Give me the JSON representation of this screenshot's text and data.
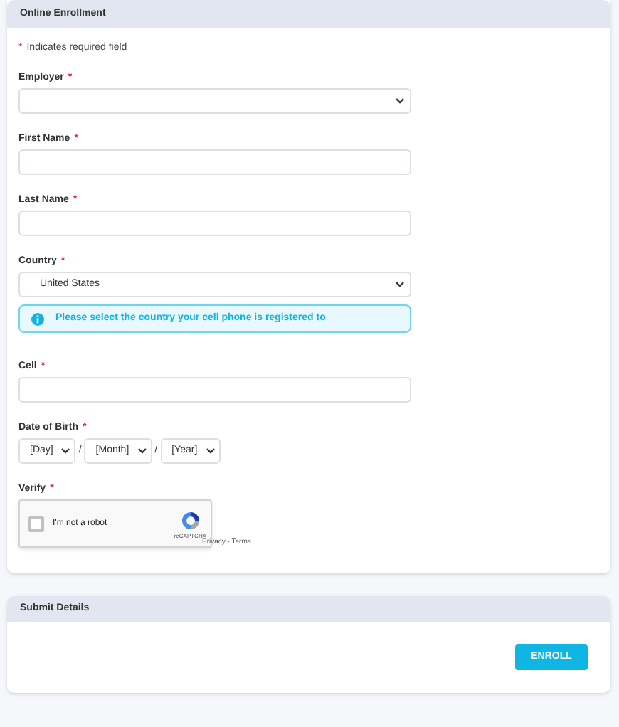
{
  "enrollment": {
    "title": "Online Enrollment",
    "required_note": {
      "mark": "*",
      "text": "Indicates required field"
    },
    "fields": [
      {
        "kind": "select",
        "label": "Employer",
        "required": true
      },
      {
        "kind": "text",
        "label": "First Name",
        "required": true
      },
      {
        "kind": "text",
        "label": "Last Name",
        "required": true
      },
      {
        "kind": "select",
        "label": "Country",
        "required": true,
        "value": "United States"
      },
      {
        "kind": "alert",
        "text": "Please select the country your cell phone is registered to"
      },
      {
        "kind": "text",
        "label": "Cell",
        "required": true
      },
      {
        "kind": "date",
        "label": "Date of Birth",
        "required": true,
        "parts": [
          "[Day]",
          "[Month]",
          "[Year]"
        ],
        "separator": "/"
      },
      {
        "kind": "captcha",
        "label": "Verify",
        "required": true,
        "checked": false,
        "text": "I'm not a robot",
        "brand": "reCAPTCHA",
        "links": "Privacy - Terms"
      }
    ]
  },
  "submit": {
    "title": "Submit Details",
    "button": "ENROLL"
  }
}
